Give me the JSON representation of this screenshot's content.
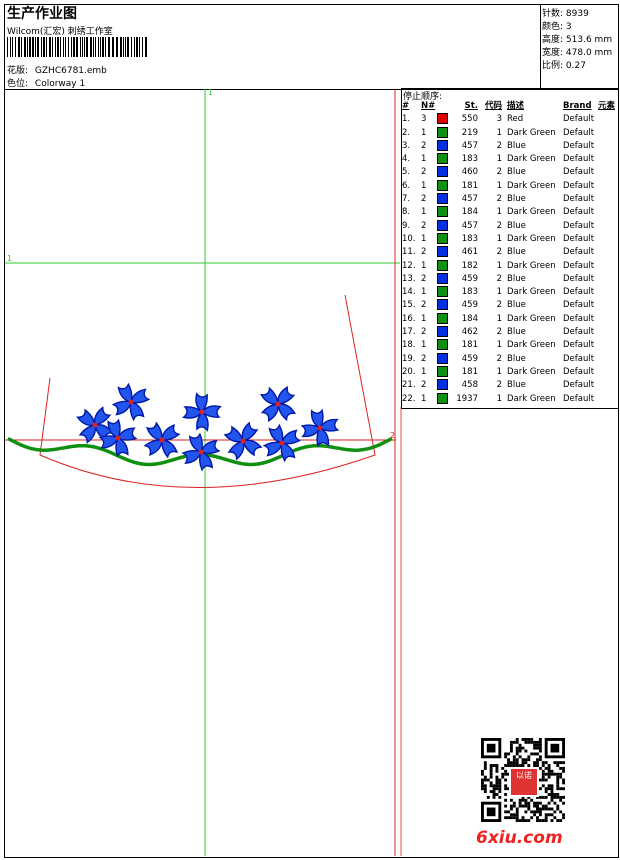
{
  "header": {
    "title": "生产作业图",
    "subtitle": "Wilcom(汇宏) 刺绣工作室",
    "pattern_label": "花版:",
    "pattern_value": "GZHC6781.emb",
    "colorway_label": "色位:",
    "colorway_value": "Colorway 1"
  },
  "stats": [
    {
      "label": "针数:",
      "value": "8939"
    },
    {
      "label": "颜色:",
      "value": "3"
    },
    {
      "label": "高度:",
      "value": "513.6 mm"
    },
    {
      "label": "宽度:",
      "value": "478.0 mm"
    },
    {
      "label": "比例:",
      "value": "0.27"
    }
  ],
  "stop_sequence": {
    "title": "停止顺序:",
    "columns": [
      "#",
      "N#",
      "St.",
      "代码",
      "描述",
      "Brand",
      "元素"
    ],
    "rows": [
      {
        "n": "1.",
        "nn": "3",
        "color": "#e00000",
        "st": "550",
        "code": "3",
        "desc": "Red",
        "brand": "Default"
      },
      {
        "n": "2.",
        "nn": "1",
        "color": "#109010",
        "st": "219",
        "code": "1",
        "desc": "Dark Green",
        "brand": "Default"
      },
      {
        "n": "3.",
        "nn": "2",
        "color": "#0030e0",
        "st": "457",
        "code": "2",
        "desc": "Blue",
        "brand": "Default"
      },
      {
        "n": "4.",
        "nn": "1",
        "color": "#109010",
        "st": "183",
        "code": "1",
        "desc": "Dark Green",
        "brand": "Default"
      },
      {
        "n": "5.",
        "nn": "2",
        "color": "#0030e0",
        "st": "460",
        "code": "2",
        "desc": "Blue",
        "brand": "Default"
      },
      {
        "n": "6.",
        "nn": "1",
        "color": "#109010",
        "st": "181",
        "code": "1",
        "desc": "Dark Green",
        "brand": "Default"
      },
      {
        "n": "7.",
        "nn": "2",
        "color": "#0030e0",
        "st": "457",
        "code": "2",
        "desc": "Blue",
        "brand": "Default"
      },
      {
        "n": "8.",
        "nn": "1",
        "color": "#109010",
        "st": "184",
        "code": "1",
        "desc": "Dark Green",
        "brand": "Default"
      },
      {
        "n": "9.",
        "nn": "2",
        "color": "#0030e0",
        "st": "457",
        "code": "2",
        "desc": "Blue",
        "brand": "Default"
      },
      {
        "n": "10.",
        "nn": "1",
        "color": "#109010",
        "st": "183",
        "code": "1",
        "desc": "Dark Green",
        "brand": "Default"
      },
      {
        "n": "11.",
        "nn": "2",
        "color": "#0030e0",
        "st": "461",
        "code": "2",
        "desc": "Blue",
        "brand": "Default"
      },
      {
        "n": "12.",
        "nn": "1",
        "color": "#109010",
        "st": "182",
        "code": "1",
        "desc": "Dark Green",
        "brand": "Default"
      },
      {
        "n": "13.",
        "nn": "2",
        "color": "#0030e0",
        "st": "459",
        "code": "2",
        "desc": "Blue",
        "brand": "Default"
      },
      {
        "n": "14.",
        "nn": "1",
        "color": "#109010",
        "st": "183",
        "code": "1",
        "desc": "Dark Green",
        "brand": "Default"
      },
      {
        "n": "15.",
        "nn": "2",
        "color": "#0030e0",
        "st": "459",
        "code": "2",
        "desc": "Blue",
        "brand": "Default"
      },
      {
        "n": "16.",
        "nn": "1",
        "color": "#109010",
        "st": "184",
        "code": "1",
        "desc": "Dark Green",
        "brand": "Default"
      },
      {
        "n": "17.",
        "nn": "2",
        "color": "#0030e0",
        "st": "462",
        "code": "2",
        "desc": "Blue",
        "brand": "Default"
      },
      {
        "n": "18.",
        "nn": "1",
        "color": "#109010",
        "st": "181",
        "code": "1",
        "desc": "Dark Green",
        "brand": "Default"
      },
      {
        "n": "19.",
        "nn": "2",
        "color": "#0030e0",
        "st": "459",
        "code": "2",
        "desc": "Blue",
        "brand": "Default"
      },
      {
        "n": "20.",
        "nn": "1",
        "color": "#109010",
        "st": "181",
        "code": "1",
        "desc": "Dark Green",
        "brand": "Default"
      },
      {
        "n": "21.",
        "nn": "2",
        "color": "#0030e0",
        "st": "458",
        "code": "2",
        "desc": "Blue",
        "brand": "Default"
      },
      {
        "n": "22.",
        "nn": "1",
        "color": "#109010",
        "st": "1937",
        "code": "1",
        "desc": "Dark Green",
        "brand": "Default"
      }
    ]
  },
  "design_markers": {
    "top_mark": "1",
    "left_mark": "1",
    "right_mark": "2"
  },
  "watermark": {
    "site": "6xiu.com",
    "seal_text": "以诺"
  },
  "colors": {
    "red": "#e00000",
    "green": "#109010",
    "blue": "#0030e0",
    "guide_green": "#33cc33",
    "guide_red": "#dd2222"
  }
}
